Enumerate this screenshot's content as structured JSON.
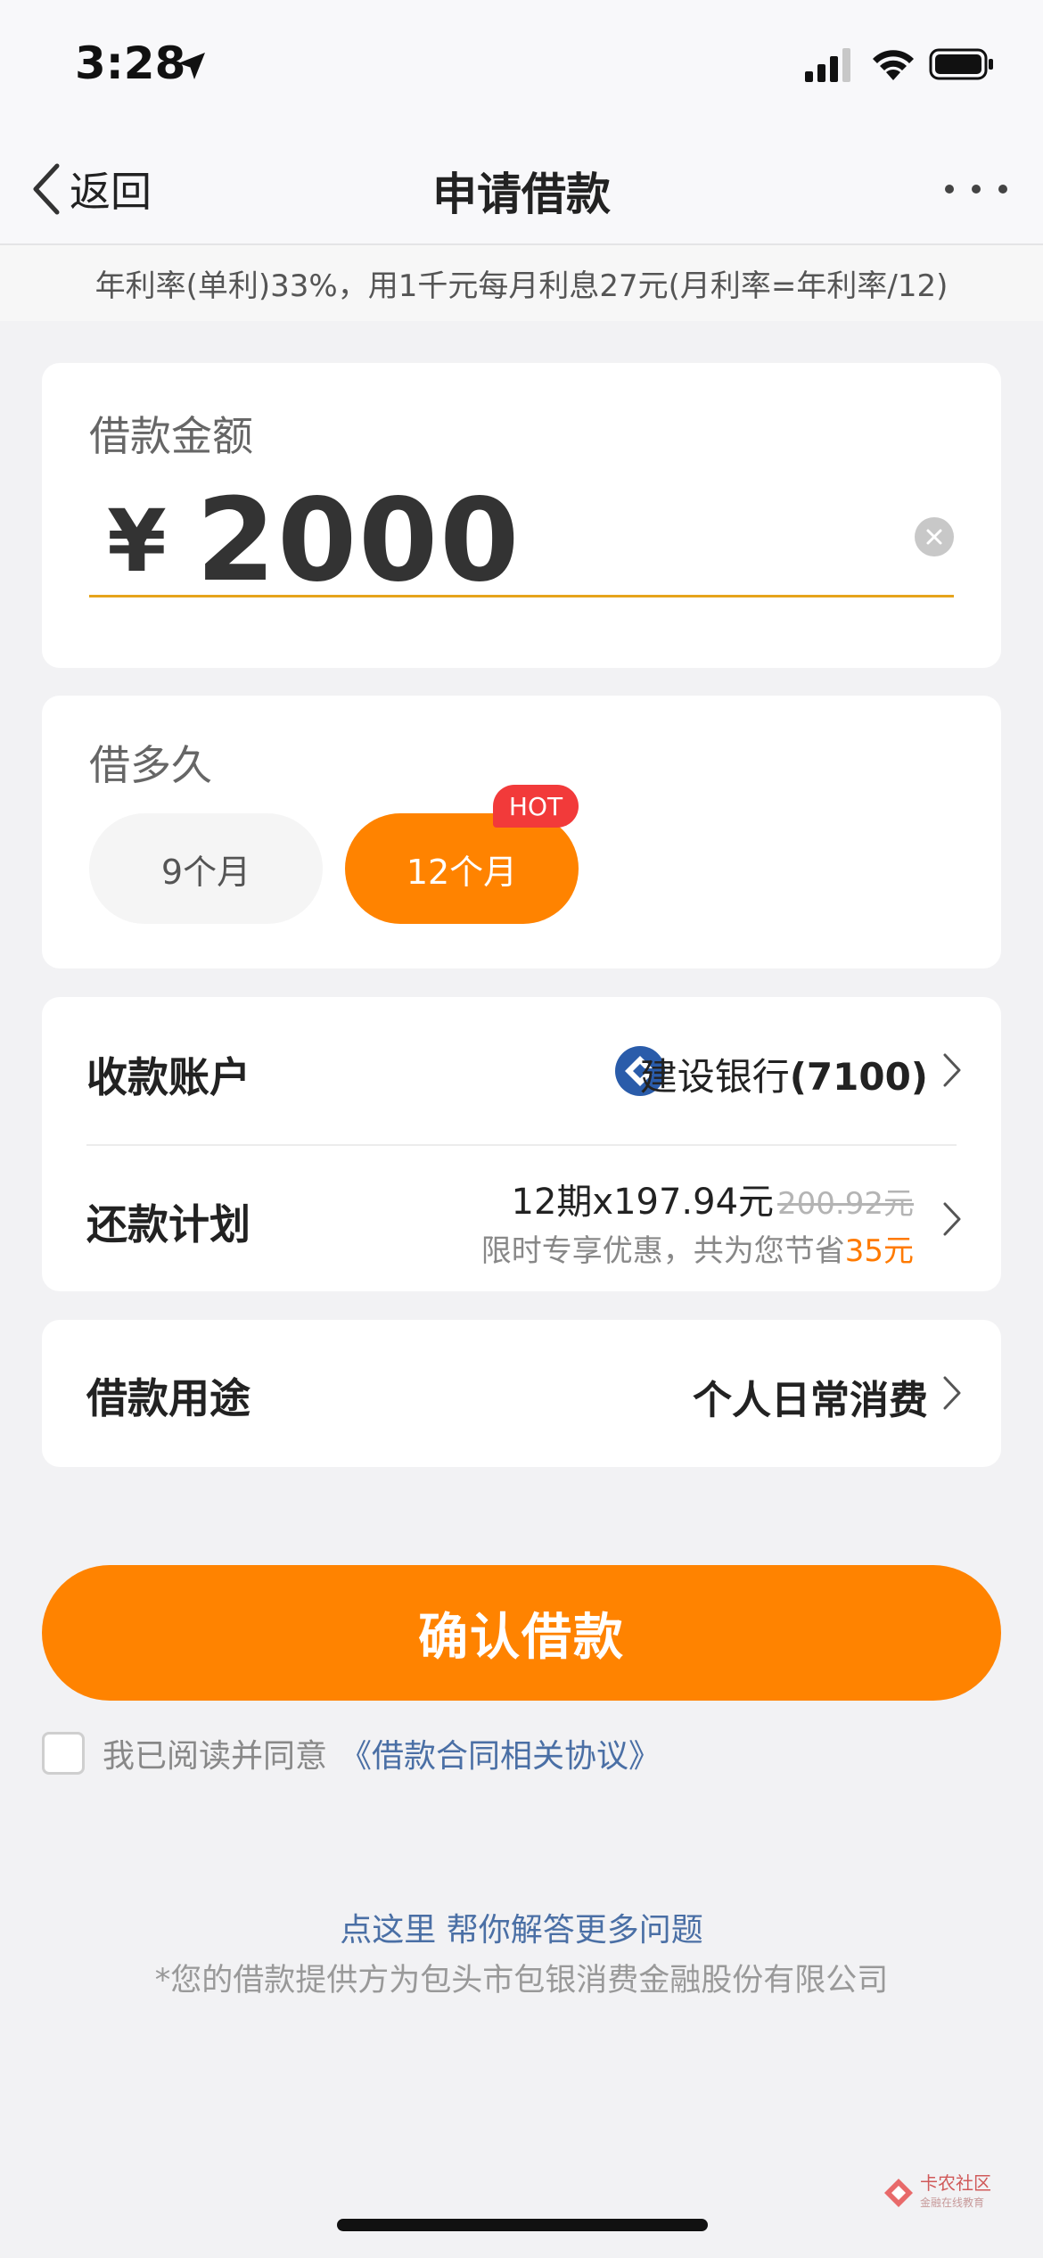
{
  "status_bar": {
    "time": "3:28"
  },
  "nav": {
    "back_label": "返回",
    "title": "申请借款"
  },
  "notice": "年利率(单利)33%，用1千元每月利息27元(月利率=年利率/12)",
  "amount": {
    "label": "借款金额",
    "currency": "¥",
    "value": "2000"
  },
  "term": {
    "label": "借多久",
    "options": [
      {
        "label": "9个月",
        "selected": false
      },
      {
        "label": "12个月",
        "selected": true
      }
    ],
    "hot_badge": "HOT"
  },
  "account": {
    "label": "收款账户",
    "bank_name": "建设银行",
    "bank_suffix": "(7100)"
  },
  "repayment": {
    "label": "还款计划",
    "plan": "12期x197.94元",
    "original": "200.92元",
    "promo_prefix": "限时专享优惠，共为您节省",
    "promo_amount": "35元"
  },
  "purpose": {
    "label": "借款用途",
    "value": "个人日常消费"
  },
  "confirm_label": "确认借款",
  "agreement": {
    "text": "我已阅读并同意",
    "link": "《借款合同相关协议》",
    "checked": false
  },
  "help_link": "点这里 帮你解答更多问题",
  "provider_note": "*您的借款提供方为包头市包银消费金融股份有限公司",
  "watermark": {
    "title": "卡农社区",
    "subtitle": "金融在线教育"
  },
  "colors": {
    "accent": "#ff8300",
    "hot": "#f23a3a",
    "link": "#4a6fa5",
    "underline": "#e6a41c",
    "bank": "#2a5caa"
  }
}
